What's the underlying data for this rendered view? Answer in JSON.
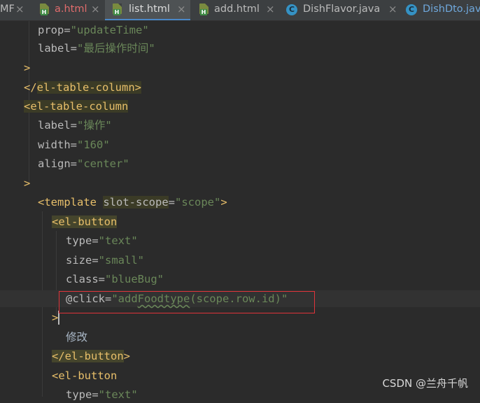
{
  "tabs": [
    {
      "label": "MF",
      "type": "partial"
    },
    {
      "label": "a.html",
      "type": "html",
      "modified": true
    },
    {
      "label": "list.html",
      "type": "html",
      "active": true
    },
    {
      "label": "add.html",
      "type": "html"
    },
    {
      "label": "DishFlavor.java",
      "type": "java"
    },
    {
      "label": "DishDto.java",
      "type": "java"
    }
  ],
  "icons": {
    "close": "×",
    "html_badge": "H",
    "java_badge": "C"
  },
  "code": {
    "l1_attr": "prop=",
    "l1_val": "\"updateTime\"",
    "l2_attr": "label=",
    "l2_val": "\"最后操作时间\"",
    "l3": ">",
    "l4_open": "</",
    "l4_tag": "el-table-column",
    "l4_close": ">",
    "l5_open": "<",
    "l5_tag": "el-table-column",
    "l6_attr": "label=",
    "l6_val": "\"操作\"",
    "l7_attr": "width=",
    "l7_val": "\"160\"",
    "l8_attr": "align=",
    "l8_val": "\"center\"",
    "l9": ">",
    "l10_tag": "<template",
    "l10_attr": "slot-scope",
    "l10_eq": "=",
    "l10_val": "\"scope\"",
    "l10_close": ">",
    "l11_open": "<",
    "l11_tag": "el-button",
    "l12_attr": "type=",
    "l12_val": "\"text\"",
    "l13_attr": "size=",
    "l13_val": "\"small\"",
    "l14_attr": "class=",
    "l14_val": "\"blueBug\"",
    "l15_attr": "@click=",
    "l15_val_a": "\"add",
    "l15_val_typo": "Foodtype",
    "l15_val_b": "(scope.row.id)\"",
    "l16": ">",
    "l17": "修改",
    "l18_open": "</",
    "l18_tag": "el-button",
    "l18_close": ">",
    "l19_open": "<",
    "l19_tag": "el-button",
    "l20_attr": "type=",
    "l20_val": "\"text\""
  },
  "watermark": "CSDN @兰舟千帆"
}
